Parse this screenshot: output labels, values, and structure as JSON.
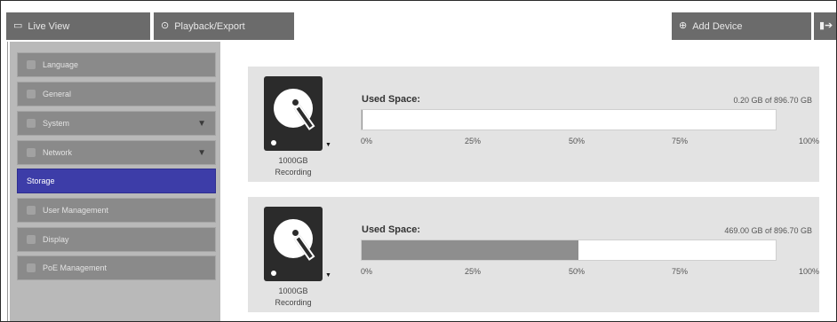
{
  "topbar": {
    "live_view": "Live View",
    "playback_export": "Playback/Export",
    "add_device": "Add Device"
  },
  "sidebar": {
    "items": [
      {
        "label": "Language"
      },
      {
        "label": "General"
      },
      {
        "label": "System",
        "has_arrow": true
      },
      {
        "label": "Network",
        "has_arrow": true
      },
      {
        "label": "Storage",
        "active": true
      },
      {
        "label": "User Management"
      },
      {
        "label": "Display"
      },
      {
        "label": "PoE Management"
      }
    ]
  },
  "drives": [
    {
      "caption_size": "1000GB",
      "caption_mode": "Recording",
      "used_label": "Used Space:",
      "used_value": "0.20 GB of 896.70 GB",
      "used_fraction": 0.0002
    },
    {
      "caption_size": "1000GB",
      "caption_mode": "Recording",
      "used_label": "Used Space:",
      "used_value": "469.00 GB of 896.70 GB",
      "used_fraction": 0.523
    }
  ],
  "ticks": [
    "0%",
    "25%",
    "50%",
    "75%",
    "100%"
  ],
  "colors": {
    "tab_bg": "#6b6b6b",
    "active_item": "#3d3da8",
    "bar_fill": "#8e8e8e"
  }
}
